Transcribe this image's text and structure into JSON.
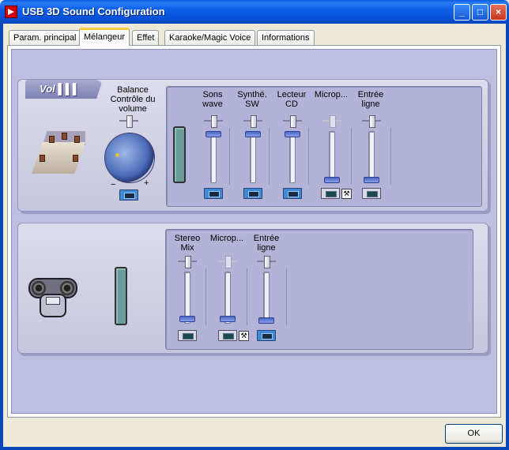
{
  "window": {
    "title": "USB 3D Sound Configuration"
  },
  "tabs": [
    {
      "label": "Param. principal",
      "active": false
    },
    {
      "label": "Mélangeur",
      "active": true
    },
    {
      "label": "Effet",
      "active": false
    },
    {
      "label": "Karaoke/Magic Voice",
      "active": false
    },
    {
      "label": "Informations",
      "active": false
    }
  ],
  "playback": {
    "badge": "Vol ▌▌▌",
    "balance_label": "Balance\nContrôle du\nvolume",
    "channels": [
      {
        "label": "Sons\nwave",
        "level": 0.9,
        "muted": false,
        "enabled": true
      },
      {
        "label": "Synthé.\nSW",
        "level": 0.9,
        "muted": false,
        "enabled": true
      },
      {
        "label": "Lecteur\nCD",
        "level": 0.9,
        "muted": false,
        "enabled": true
      },
      {
        "label": "Microp...",
        "level": 0.0,
        "muted": true,
        "enabled": false,
        "advanced": true
      },
      {
        "label": "Entrée\nligne",
        "level": 0.0,
        "muted": true,
        "enabled": true
      }
    ]
  },
  "recording": {
    "channels": [
      {
        "label": "Stereo\nMix",
        "level": 0.0,
        "muted": true,
        "enabled": true
      },
      {
        "label": "Microp...",
        "level": 0.0,
        "muted": true,
        "enabled": false,
        "advanced": true
      },
      {
        "label": "Entrée\nligne",
        "level": 0.0,
        "muted": false,
        "enabled": true
      }
    ]
  },
  "knob": {
    "minus": "−",
    "plus": "+"
  },
  "icons": {
    "advanced": "wrench-icon"
  },
  "buttons": {
    "ok": "OK"
  }
}
